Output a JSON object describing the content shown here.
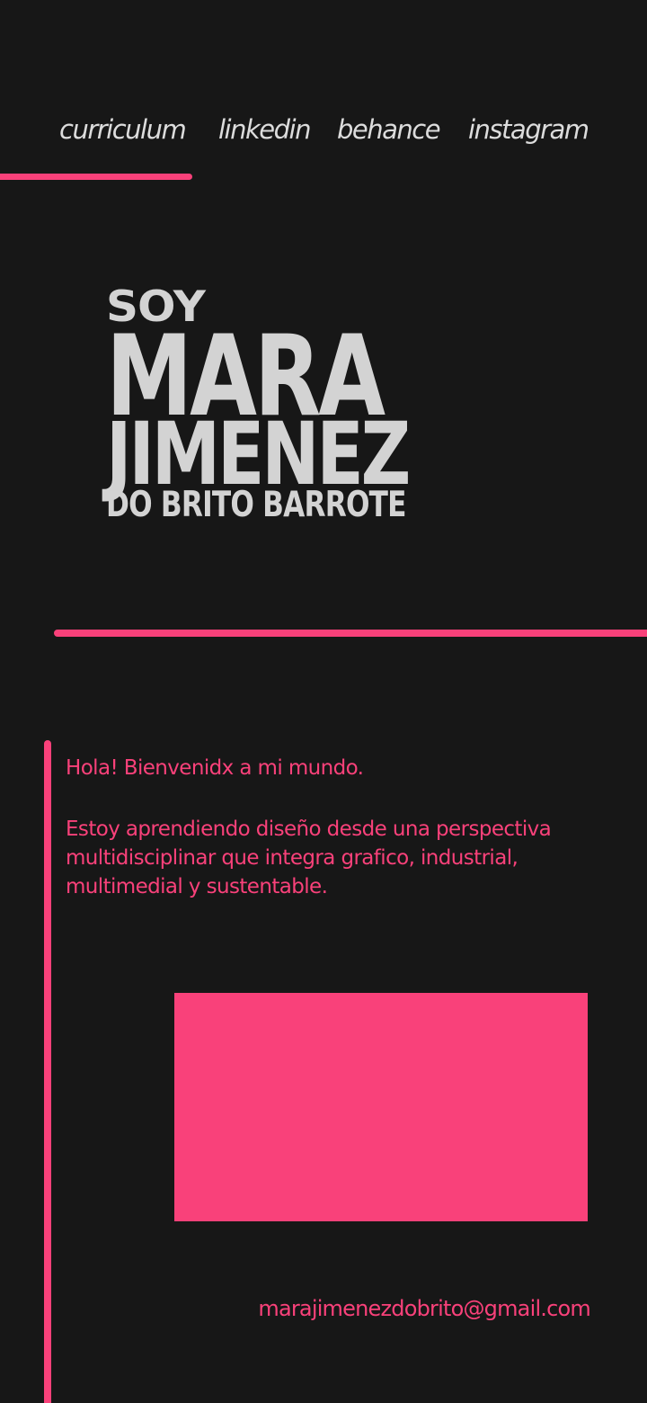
{
  "theme": {
    "background": "#171717",
    "accent": "#f9417a",
    "text_light": "#d3d3d3"
  },
  "nav": {
    "items": [
      {
        "label": "curriculum"
      },
      {
        "label": "linkedin"
      },
      {
        "label": "behance"
      },
      {
        "label": "instagram"
      }
    ]
  },
  "hero": {
    "intro_word": "SOY",
    "first_name": "MARA",
    "last_name": "JIMENEZ",
    "surnames": "DO BRITO BARROTE"
  },
  "about": {
    "greeting": "Hola! Bienvenidx a mi mundo.",
    "description": "Estoy aprendiendo diseño desde una perspectiva multidisciplinar que integra grafico, industrial, multimedial y sustentable."
  },
  "contact": {
    "email": "marajimenezdobrito@gmail.com"
  }
}
